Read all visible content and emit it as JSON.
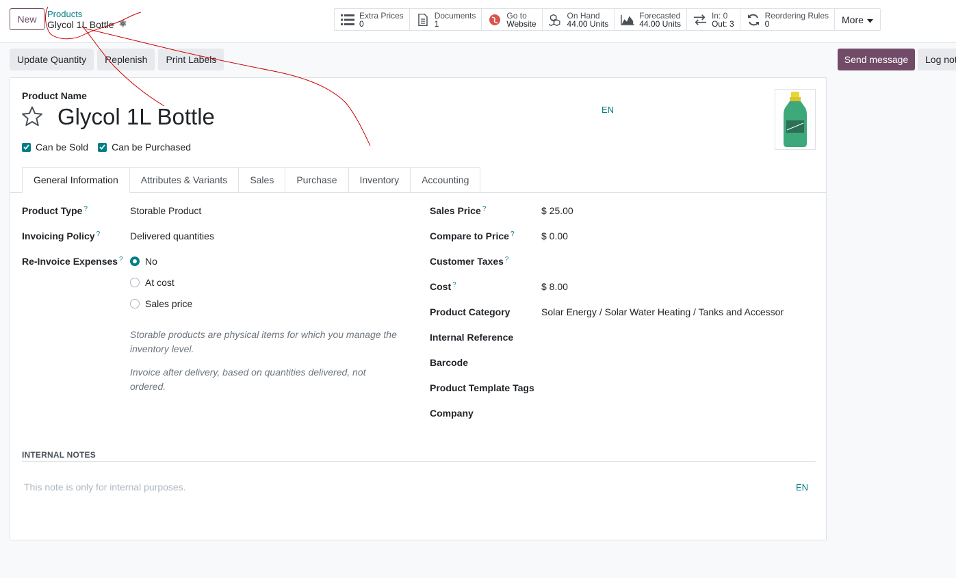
{
  "header": {
    "new_label": "New",
    "breadcrumb_parent": "Products",
    "breadcrumb_current": "Glycol 1L Bottle"
  },
  "smart_buttons": [
    {
      "label": "Extra Prices",
      "value": "0",
      "icon": "list-icon"
    },
    {
      "label": "Documents",
      "value": "1",
      "icon": "document-icon"
    },
    {
      "label": "Go to",
      "value": "Website",
      "icon": "globe-icon"
    },
    {
      "label": "On Hand",
      "value": "44.00 Units",
      "icon": "cubes-icon"
    },
    {
      "label": "Forecasted",
      "value": "44.00 Units",
      "icon": "area-chart-icon"
    },
    {
      "label": "In: 0",
      "value": "Out: 3",
      "icon": "exchange-icon"
    },
    {
      "label": "Reordering Rules",
      "value": "0",
      "icon": "refresh-icon"
    }
  ],
  "more_label": "More",
  "actions": {
    "update_quantity": "Update Quantity",
    "replenish": "Replenish",
    "print_labels": "Print Labels",
    "send_message": "Send message",
    "log_note": "Log note"
  },
  "form": {
    "product_name_label": "Product Name",
    "product_name": "Glycol 1L Bottle",
    "lang": "EN",
    "can_be_sold": "Can be Sold",
    "can_be_purchased": "Can be Purchased",
    "tabs": [
      "General Information",
      "Attributes & Variants",
      "Sales",
      "Purchase",
      "Inventory",
      "Accounting"
    ],
    "left_fields": {
      "product_type_label": "Product Type",
      "product_type": "Storable Product",
      "invoicing_policy_label": "Invoicing Policy",
      "invoicing_policy": "Delivered quantities",
      "reinvoice_label": "Re-Invoice Expenses",
      "reinvoice_options": [
        "No",
        "At cost",
        "Sales price"
      ],
      "help_1": "Storable products are physical items for which you manage the inventory level.",
      "help_2": "Invoice after delivery, based on quantities delivered, not ordered."
    },
    "right_fields": {
      "sales_price_label": "Sales Price",
      "sales_price": "$ 25.00",
      "compare_price_label": "Compare to Price",
      "compare_price": "$ 0.00",
      "customer_taxes_label": "Customer Taxes",
      "cost_label": "Cost",
      "cost": "$ 8.00",
      "category_label": "Product Category",
      "category": "Solar Energy / Solar Water Heating / Tanks and Accessorie",
      "internal_ref_label": "Internal Reference",
      "barcode_label": "Barcode",
      "tags_label": "Product Template Tags",
      "company_label": "Company"
    },
    "help_mark": "?",
    "internal_notes_title": "INTERNAL NOTES",
    "internal_notes_placeholder": "This note is only for internal purposes."
  },
  "colors": {
    "brand": "#714b67",
    "accent": "#017e84",
    "annotation": "#cc0000"
  }
}
